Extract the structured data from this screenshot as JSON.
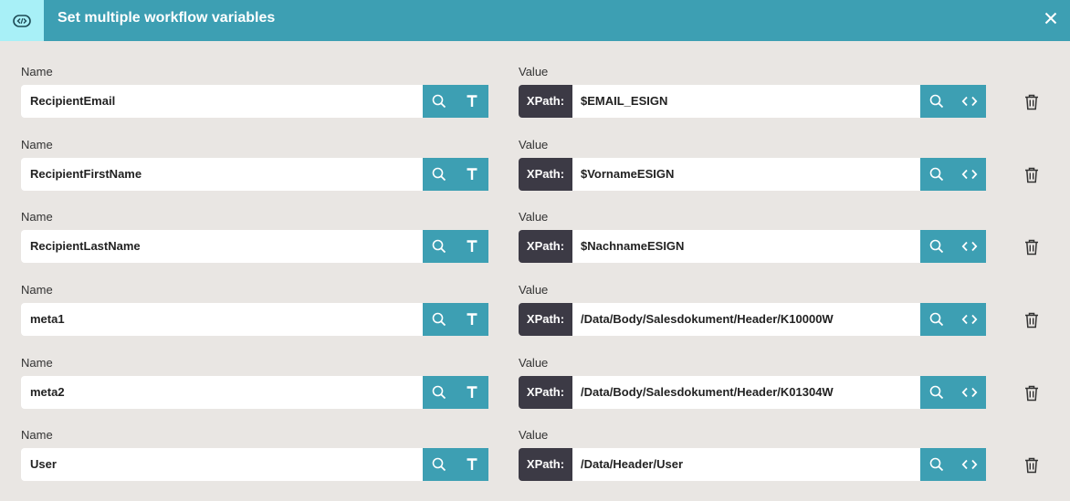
{
  "dialog": {
    "title": "Set multiple workflow variables",
    "header_icon": "code-block-icon",
    "close_icon": "close-icon",
    "colors": {
      "header": "#3d9fb3",
      "header_icon_bg": "#a8f0f7",
      "button": "#3d9fb3",
      "xpath_tag": "#3c3a45",
      "background": "#e9e6e3"
    }
  },
  "rows": [
    {
      "name_label": "Name",
      "name": "RecipientEmail",
      "value_label": "Value",
      "value_type": "XPath:",
      "value": "$EMAIL_ESIGN"
    },
    {
      "name_label": "Name",
      "name": "RecipientFirstName",
      "value_label": "Value",
      "value_type": "XPath:",
      "value": "$VornameESIGN"
    },
    {
      "name_label": "Name",
      "name": "RecipientLastName",
      "value_label": "Value",
      "value_type": "XPath:",
      "value": "$NachnameESIGN"
    },
    {
      "name_label": "Name",
      "name": "meta1",
      "value_label": "Value",
      "value_type": "XPath:",
      "value": "/Data/Body/Salesdokument/Header/K10000W"
    },
    {
      "name_label": "Name",
      "name": "meta2",
      "value_label": "Value",
      "value_type": "XPath:",
      "value": "/Data/Body/Salesdokument/Header/K01304W"
    },
    {
      "name_label": "Name",
      "name": "User",
      "value_label": "Value",
      "value_type": "XPath:",
      "value": "/Data/Header/User"
    }
  ],
  "icons": {
    "search": "search-icon",
    "text_type": "text-type-icon",
    "code": "code-icon",
    "delete": "trash-icon"
  }
}
